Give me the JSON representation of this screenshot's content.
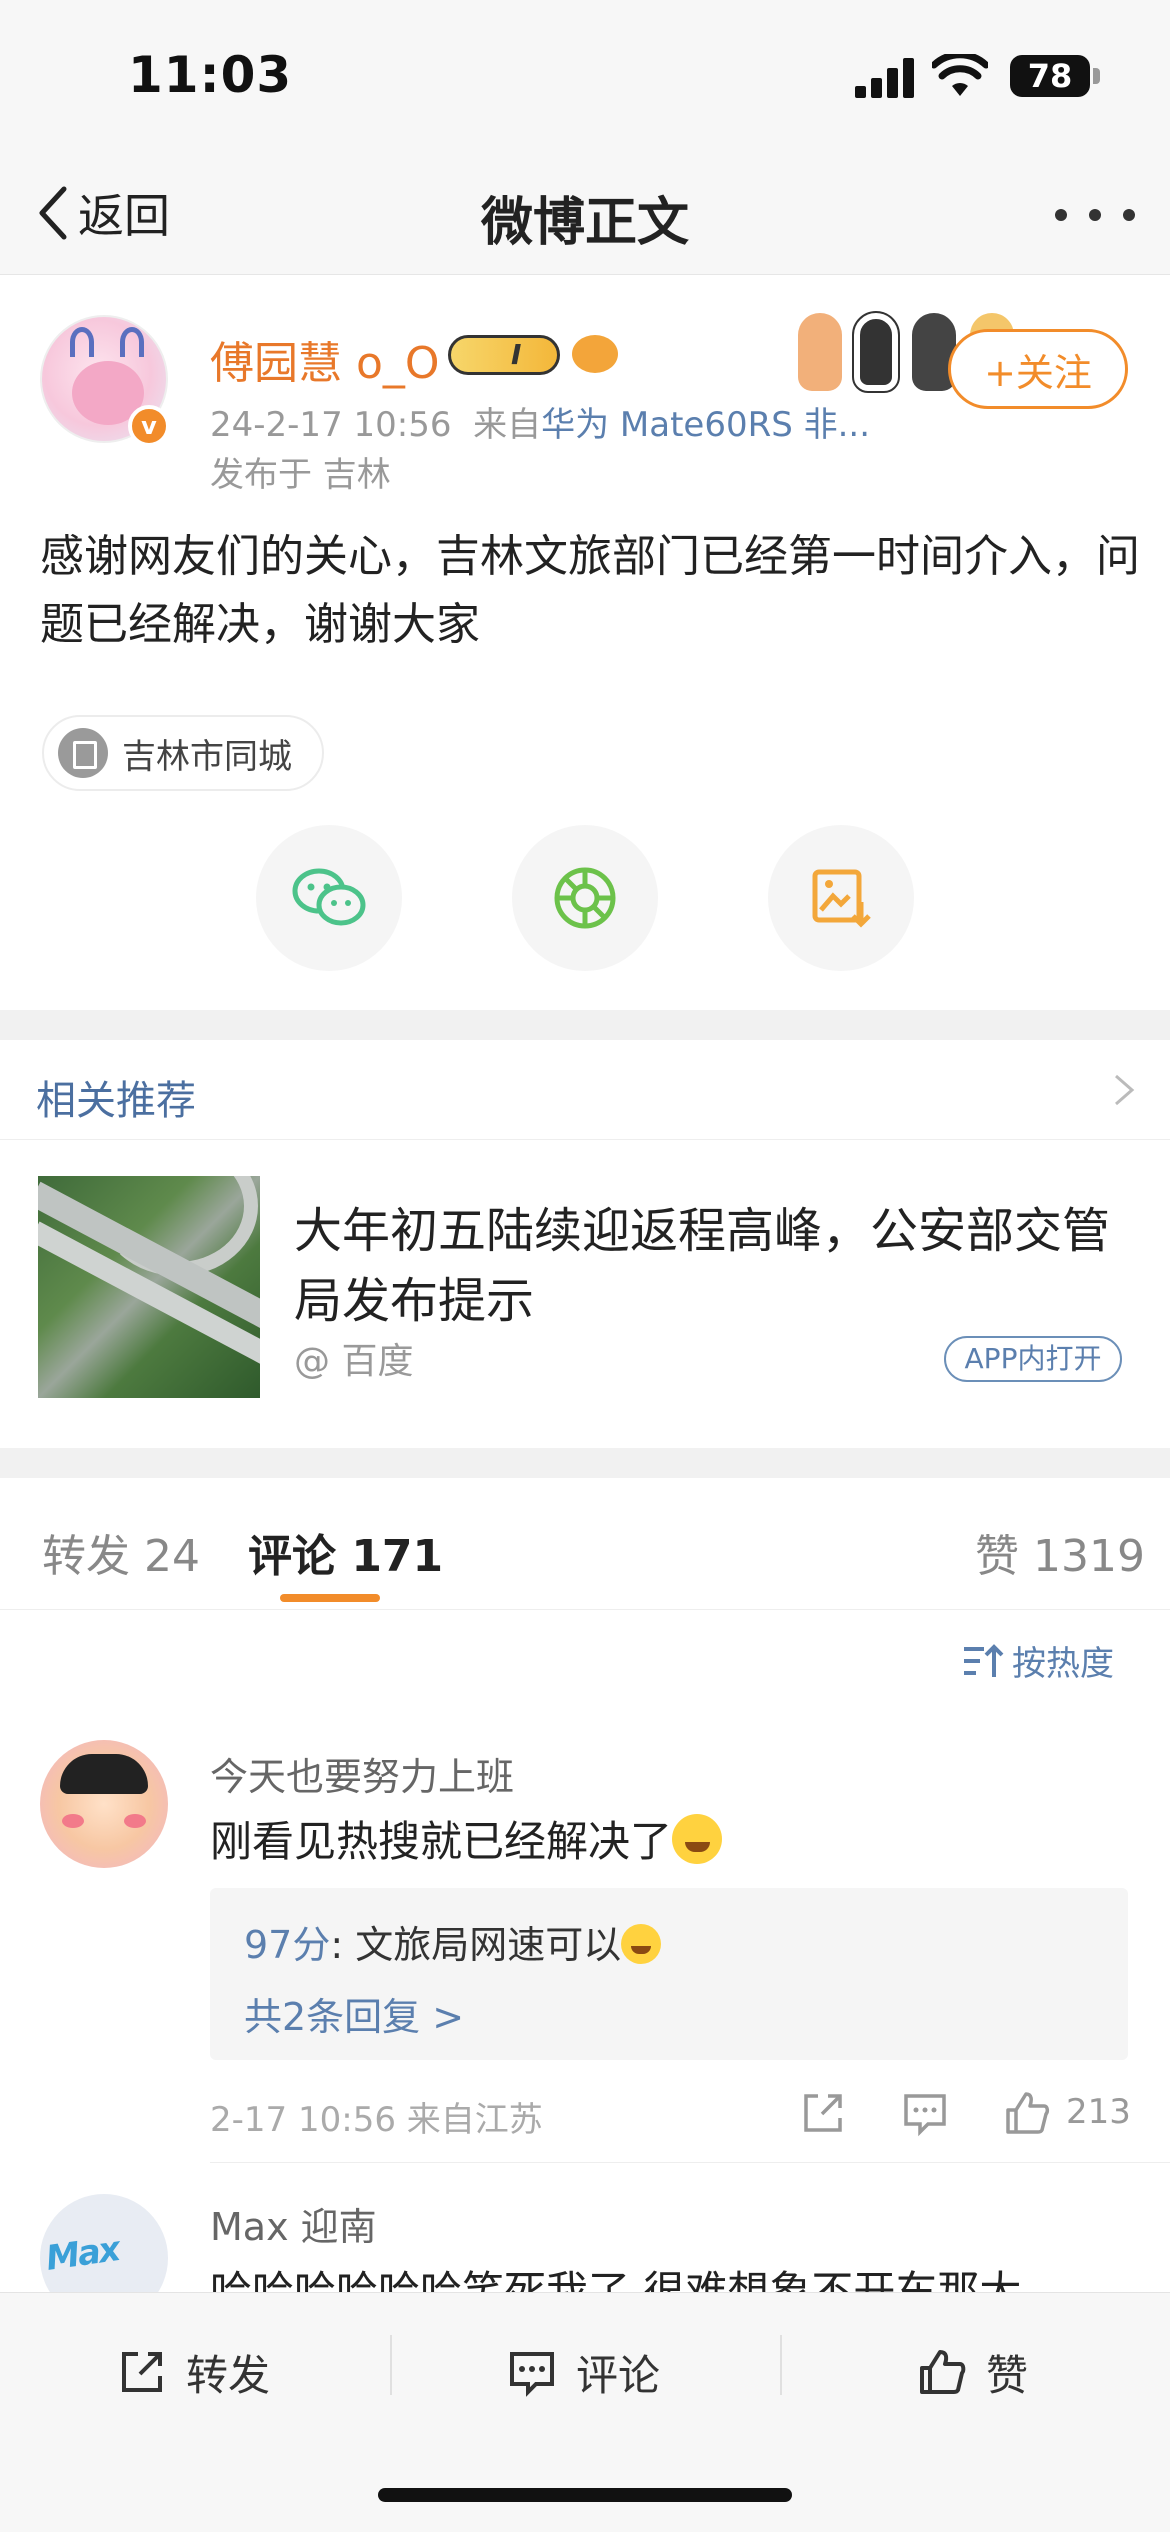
{
  "status_bar": {
    "time": "11:03",
    "battery": "78"
  },
  "nav": {
    "back_label": "返回",
    "title": "微博正文"
  },
  "post": {
    "author": "傅园慧 o_O",
    "timestamp": "24-2-17 10:56",
    "source_prefix": "来自",
    "device": "华为 Mate60RS 非...",
    "location": "发布于 吉林",
    "follow_label": "+关注",
    "content": "感谢网友们的关心，吉林文旅部门已经第一时间介入，问题已经解决，谢谢大家",
    "topic": "吉林市同城",
    "share_icons": [
      "wechat-icon",
      "moments-icon",
      "save-image-icon"
    ]
  },
  "related": {
    "title": "相关推荐",
    "headline": "大年初五陆续迎返程高峰，公安部交管局发布提示",
    "source": "@ 百度",
    "open_label": "APP内打开"
  },
  "tabs": {
    "repost": "转发 24",
    "comments": "评论 171",
    "likes": "赞 1319",
    "sort_label": "按热度"
  },
  "comments": [
    {
      "name": "今天也要努力上班",
      "text": "刚看见热搜就已经解决了",
      "reply_author": "97分",
      "reply_text": ": 文旅局网速可以",
      "reply_count": "共2条回复 >",
      "time": "2-17 10:56  来自江苏",
      "likes": "213"
    },
    {
      "name": "Max 迎南",
      "text": "哈哈哈哈哈哈笑死我了 很难想象不开车那大"
    }
  ],
  "bottom_bar": {
    "repost": "转发",
    "comment": "评论",
    "like": "赞"
  },
  "colors": {
    "accent_orange": "#f28c2a",
    "link_blue": "#5b7fae"
  }
}
